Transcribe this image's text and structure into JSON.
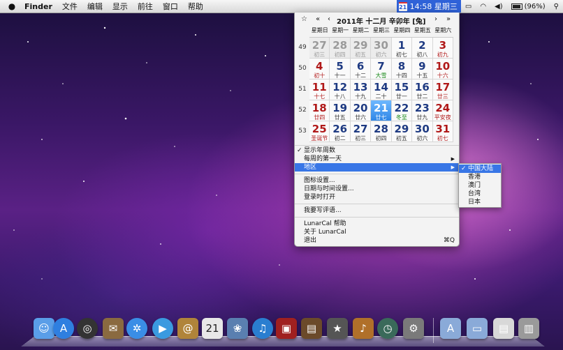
{
  "menubar": {
    "app_name": "Finder",
    "menus": [
      "文件",
      "编辑",
      "显示",
      "前往",
      "窗口",
      "帮助"
    ],
    "clock_badge": "21",
    "clock_text": "14:58 星期三",
    "battery_text": "(96%)"
  },
  "calendar": {
    "nav": {
      "star": "☆",
      "prev_year": "«",
      "prev_month": "‹",
      "title": "2011年  十二月  辛卯年 [兔]",
      "next_month": "›",
      "next_year": "»"
    },
    "weekday_headers": [
      "星期日",
      "星期一",
      "星期二",
      "星期三",
      "星期四",
      "星期五",
      "星期六"
    ],
    "week_numbers": [
      "49",
      "50",
      "51",
      "52",
      "53"
    ],
    "weeks": [
      [
        {
          "day": "27",
          "lunar": "初三",
          "kind": "other"
        },
        {
          "day": "28",
          "lunar": "初四",
          "kind": "other"
        },
        {
          "day": "29",
          "lunar": "初五",
          "kind": "other"
        },
        {
          "day": "30",
          "lunar": "初六",
          "kind": "other"
        },
        {
          "day": "1",
          "lunar": "初七",
          "kind": "wkd"
        },
        {
          "day": "2",
          "lunar": "初八",
          "kind": "wkd"
        },
        {
          "day": "3",
          "lunar": "初九",
          "kind": "wke"
        }
      ],
      [
        {
          "day": "4",
          "lunar": "初十",
          "kind": "wke"
        },
        {
          "day": "5",
          "lunar": "十一",
          "kind": "wkd"
        },
        {
          "day": "6",
          "lunar": "十二",
          "kind": "wkd"
        },
        {
          "day": "7",
          "lunar": "大雪",
          "kind": "wkd fest"
        },
        {
          "day": "8",
          "lunar": "十四",
          "kind": "wkd"
        },
        {
          "day": "9",
          "lunar": "十五",
          "kind": "wkd"
        },
        {
          "day": "10",
          "lunar": "十六",
          "kind": "wke"
        }
      ],
      [
        {
          "day": "11",
          "lunar": "十七",
          "kind": "wke"
        },
        {
          "day": "12",
          "lunar": "十八",
          "kind": "wkd"
        },
        {
          "day": "13",
          "lunar": "十九",
          "kind": "wkd"
        },
        {
          "day": "14",
          "lunar": "二十",
          "kind": "wkd"
        },
        {
          "day": "15",
          "lunar": "廿一",
          "kind": "wkd"
        },
        {
          "day": "16",
          "lunar": "廿二",
          "kind": "wkd"
        },
        {
          "day": "17",
          "lunar": "廿三",
          "kind": "wke"
        }
      ],
      [
        {
          "day": "18",
          "lunar": "廿四",
          "kind": "wke"
        },
        {
          "day": "19",
          "lunar": "廿五",
          "kind": "wkd"
        },
        {
          "day": "20",
          "lunar": "廿六",
          "kind": "wkd"
        },
        {
          "day": "21",
          "lunar": "廿七",
          "kind": "wkd today"
        },
        {
          "day": "22",
          "lunar": "冬至",
          "kind": "wkd fest"
        },
        {
          "day": "23",
          "lunar": "廿九",
          "kind": "wkd"
        },
        {
          "day": "24",
          "lunar": "平安夜",
          "kind": "wke"
        }
      ],
      [
        {
          "day": "25",
          "lunar": "圣诞节",
          "kind": "wke"
        },
        {
          "day": "26",
          "lunar": "初二",
          "kind": "wkd"
        },
        {
          "day": "27",
          "lunar": "初三",
          "kind": "wkd"
        },
        {
          "day": "28",
          "lunar": "初四",
          "kind": "wkd"
        },
        {
          "day": "29",
          "lunar": "初五",
          "kind": "wkd"
        },
        {
          "day": "30",
          "lunar": "初六",
          "kind": "wkd"
        },
        {
          "day": "31",
          "lunar": "初七",
          "kind": "wke"
        }
      ]
    ]
  },
  "menu": {
    "show_week_numbers": "显示年周数",
    "first_day_of_week": "每周的第一天",
    "region": "地区",
    "icon_settings": "图标设置...",
    "datetime_settings": "日期与时间设置...",
    "open_at_login": "登录时打开",
    "write_review": "我要写评语...",
    "help": "LunarCal 帮助",
    "about": "关于 LunarCal",
    "quit": "退出",
    "quit_shortcut": "⌘Q"
  },
  "region_submenu": [
    "中国大陆",
    "香港",
    "澳门",
    "台湾",
    "日本"
  ],
  "dock": [
    {
      "name": "finder",
      "glyph": "☺",
      "color": "#5a9ee8"
    },
    {
      "name": "app-store",
      "glyph": "A",
      "color": "#2f7fe0"
    },
    {
      "name": "dashboard",
      "glyph": "◎",
      "color": "#333333"
    },
    {
      "name": "mail",
      "glyph": "✉",
      "color": "#8a6a40"
    },
    {
      "name": "safari",
      "glyph": "✲",
      "color": "#3a8ee6"
    },
    {
      "name": "facetime",
      "glyph": "▶",
      "color": "#3a9ae0"
    },
    {
      "name": "address-book",
      "glyph": "@",
      "color": "#b0843a"
    },
    {
      "name": "ical",
      "glyph": "21",
      "color": "#e8e8e8"
    },
    {
      "name": "iphoto",
      "glyph": "❀",
      "color": "#5a7fb0"
    },
    {
      "name": "itunes",
      "glyph": "♫",
      "color": "#2a7ed0"
    },
    {
      "name": "photo-booth",
      "glyph": "▣",
      "color": "#a02020"
    },
    {
      "name": "preview",
      "glyph": "▤",
      "color": "#6b4a2a"
    },
    {
      "name": "imovie",
      "glyph": "★",
      "color": "#555555"
    },
    {
      "name": "garageband",
      "glyph": "♪",
      "color": "#b0702a"
    },
    {
      "name": "time-machine",
      "glyph": "◷",
      "color": "#3a6a5a"
    },
    {
      "name": "system-preferences",
      "glyph": "⚙",
      "color": "#7a7a7a"
    },
    {
      "name": "applications-folder",
      "glyph": "A",
      "color": "#8aaad8"
    },
    {
      "name": "documents-folder",
      "glyph": "▭",
      "color": "#8aaad8"
    },
    {
      "name": "downloads-stack",
      "glyph": "▤",
      "color": "#d8d8d8"
    },
    {
      "name": "trash",
      "glyph": "▥",
      "color": "#9a9a9a"
    }
  ]
}
